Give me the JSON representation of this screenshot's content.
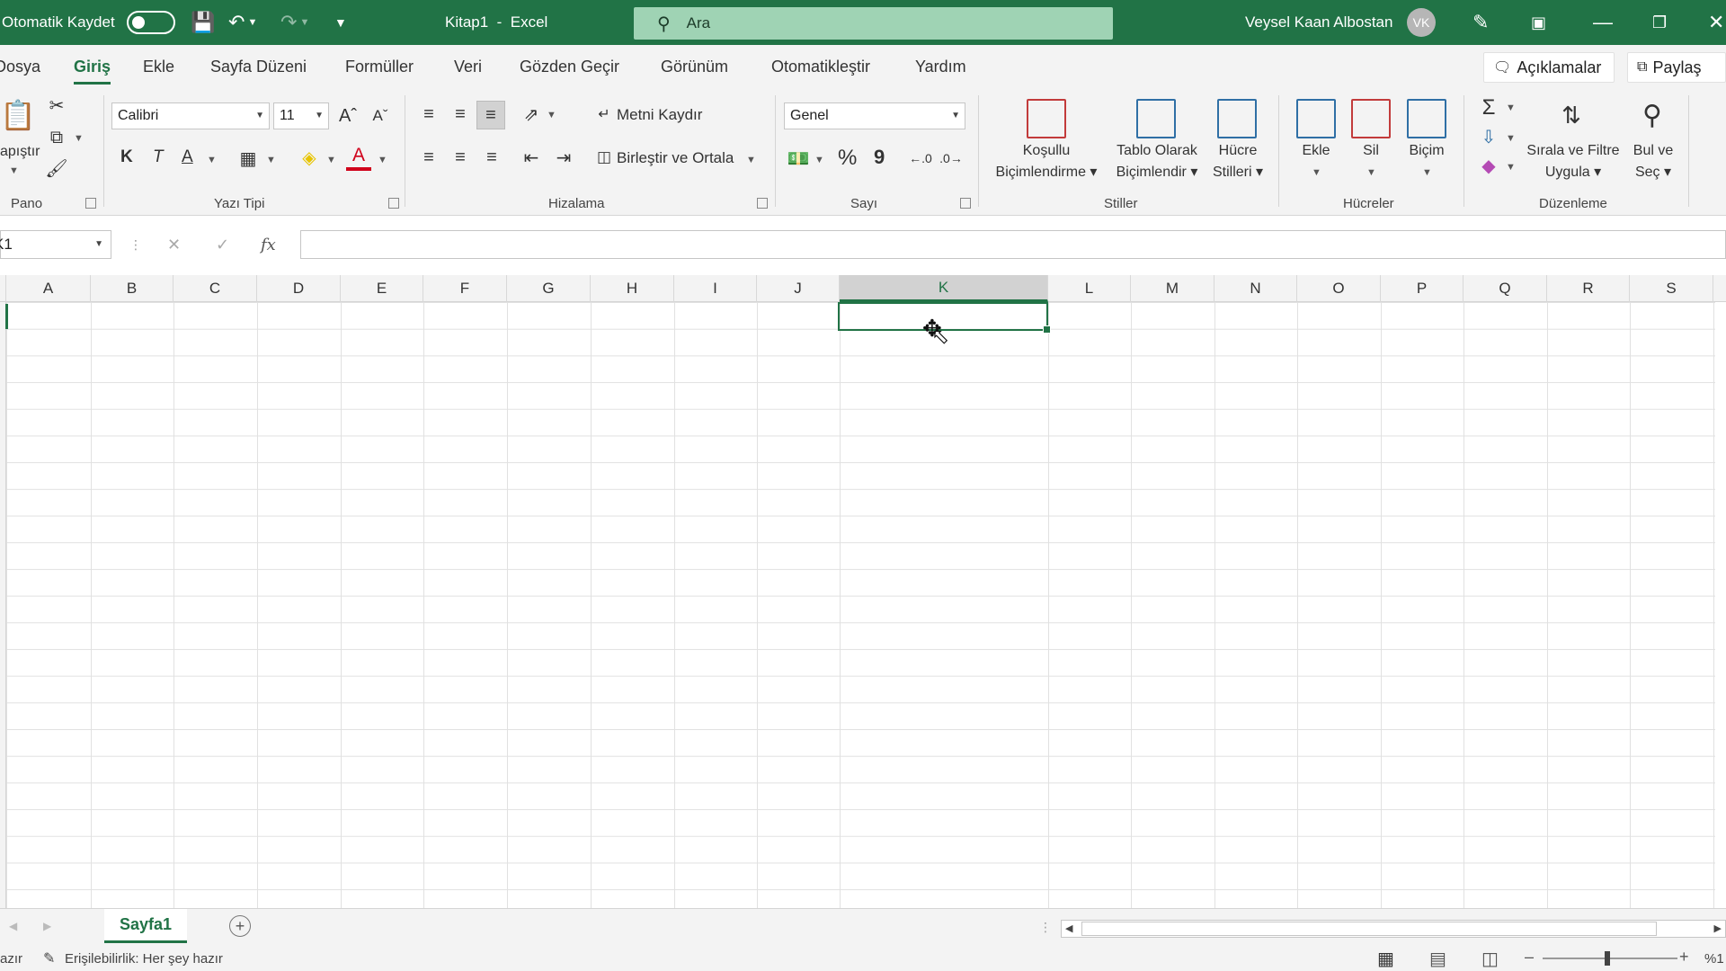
{
  "titlebar": {
    "autosave_label": "Otomatik Kaydet",
    "doc_title": "Kitap1  -  Excel",
    "search_placeholder": "Ara",
    "user_name": "Veysel Kaan Albostan",
    "user_initials": "VK"
  },
  "tabs": [
    "Dosya",
    "Giriş",
    "Ekle",
    "Sayfa Düzeni",
    "Formüller",
    "Veri",
    "Gözden Geçir",
    "Görünüm",
    "Otomatikleştir",
    "Yardım"
  ],
  "active_tab": "Giriş",
  "tab_actions": {
    "comments": "Açıklamalar",
    "share": "Paylaş"
  },
  "ribbon": {
    "clipboard": {
      "paste_label": "apıştır",
      "group": "Pano"
    },
    "font": {
      "font_name": "Calibri",
      "font_size": "11",
      "bold": "K",
      "italic": "T",
      "underline": "A",
      "group": "Yazı Tipi"
    },
    "alignment": {
      "wrap_text": "Metni Kaydır",
      "merge_center": "Birleştir ve Ortala",
      "group": "Hizalama"
    },
    "number": {
      "format": "Genel",
      "percent": "%",
      "comma": "9",
      "group": "Sayı"
    },
    "styles": {
      "conditional_l1": "Koşullu",
      "conditional_l2": "Biçimlendirme",
      "table_l1": "Tablo Olarak",
      "table_l2": "Biçimlendir",
      "cell_l1": "Hücre",
      "cell_l2": "Stilleri",
      "group": "Stiller"
    },
    "cells": {
      "insert": "Ekle",
      "delete": "Sil",
      "format": "Biçim",
      "group": "Hücreler"
    },
    "editing": {
      "sort_l1": "Sırala ve Filtre",
      "sort_l2": "Uygula",
      "find_l1": "Bul ve",
      "find_l2": "Seç",
      "group": "Düzenleme"
    }
  },
  "formula_bar": {
    "name_box": "K1",
    "fx": "fx",
    "value": ""
  },
  "columns": [
    "A",
    "B",
    "C",
    "D",
    "E",
    "F",
    "G",
    "H",
    "I",
    "J",
    "K",
    "L",
    "M",
    "N",
    "O",
    "P",
    "Q",
    "R",
    "S"
  ],
  "selected_column": "K",
  "sheets": [
    "Sayfa1"
  ],
  "status": {
    "ready": "azır",
    "accessibility": "Erişilebilirlik: Her şey hazır",
    "zoom": "%1"
  },
  "colors": {
    "brand": "#217346",
    "search_bg": "#9fd3b4"
  }
}
